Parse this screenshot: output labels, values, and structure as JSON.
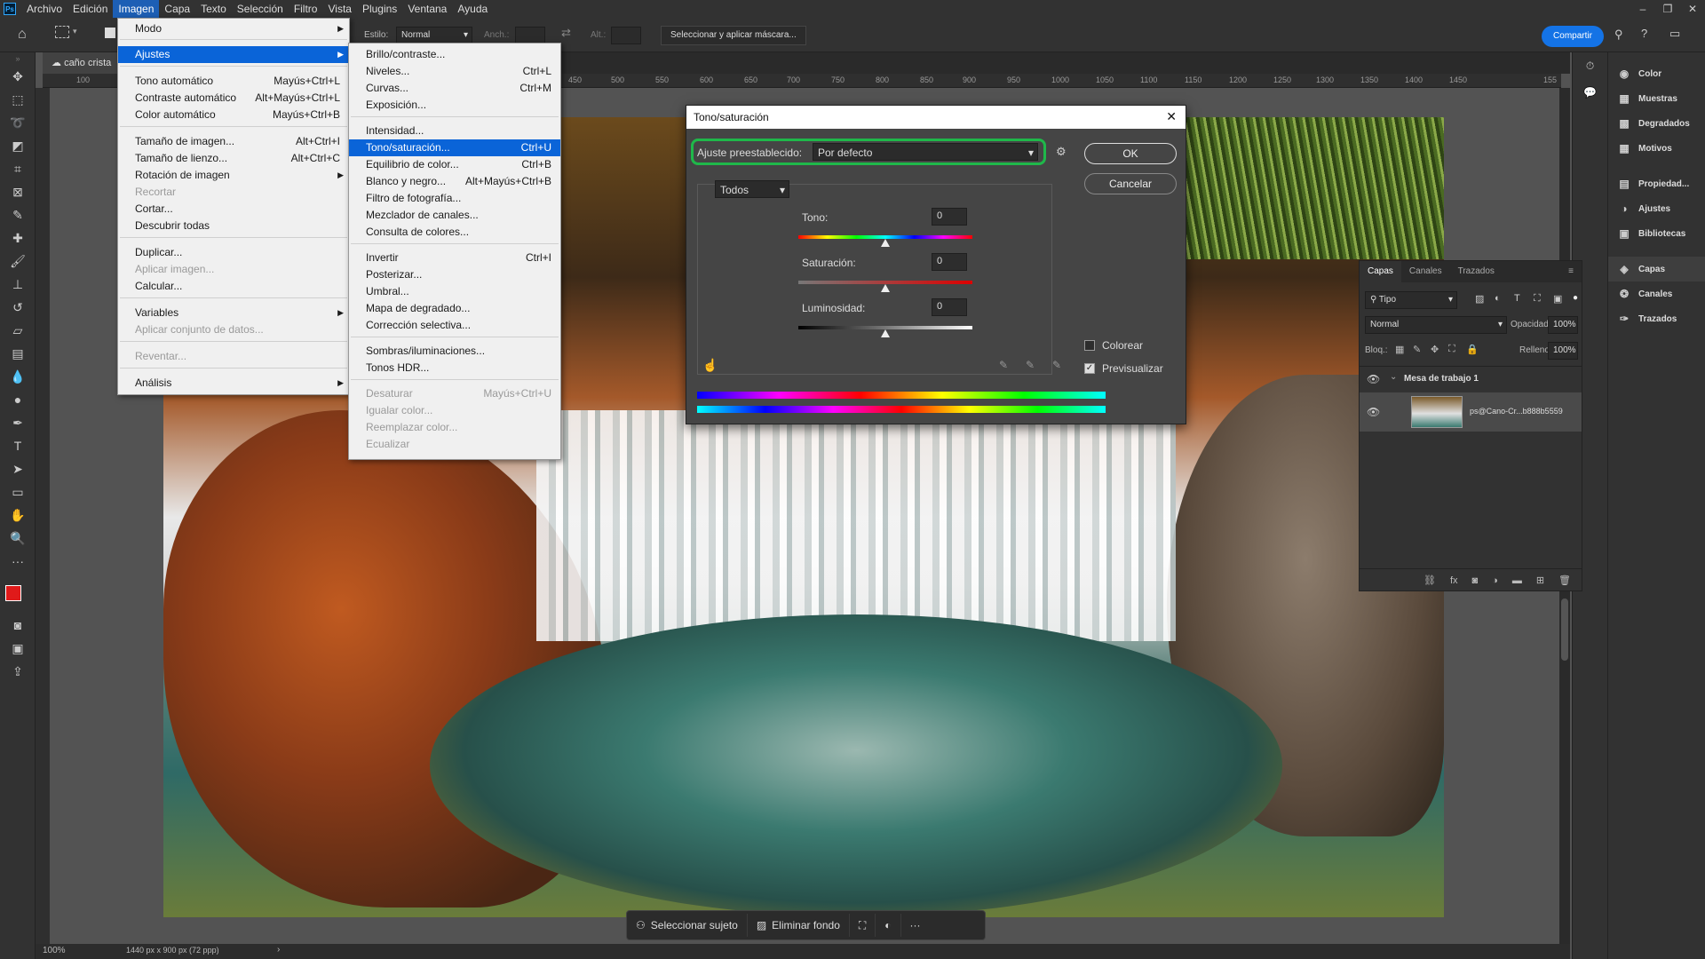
{
  "app": {
    "logo": "Ps"
  },
  "menubar": [
    "Archivo",
    "Edición",
    "Imagen",
    "Capa",
    "Texto",
    "Selección",
    "Filtro",
    "Vista",
    "Plugins",
    "Ventana",
    "Ayuda"
  ],
  "options": {
    "estilo_label": "Estilo:",
    "estilo_value": "Normal",
    "anch_label": "Anch.:",
    "alt_label": "Alt.:",
    "mask_button": "Seleccionar y aplicar máscara...",
    "share_button": "Compartir"
  },
  "doc_tab": {
    "name": "caño crista"
  },
  "ruler_ticks": [
    "100",
    "450",
    "500",
    "550",
    "600",
    "650",
    "700",
    "750",
    "800",
    "850",
    "900",
    "950",
    "1000",
    "1050",
    "1100",
    "1150",
    "1200",
    "1250",
    "1300",
    "1350",
    "1400",
    "1450",
    "155"
  ],
  "image_menu": {
    "items": [
      {
        "label": "Modo",
        "shortcut": "",
        "submenu": true,
        "disabled": false
      },
      {
        "label": "Ajustes",
        "shortcut": "",
        "submenu": true,
        "disabled": false,
        "highlighted": true
      },
      {
        "label": "Tono automático",
        "shortcut": "Mayús+Ctrl+L",
        "disabled": false
      },
      {
        "label": "Contraste automático",
        "shortcut": "Alt+Mayús+Ctrl+L",
        "disabled": false
      },
      {
        "label": "Color automático",
        "shortcut": "Mayús+Ctrl+B",
        "disabled": false
      },
      {
        "label": "Tamaño de imagen...",
        "shortcut": "Alt+Ctrl+I",
        "disabled": false
      },
      {
        "label": "Tamaño de lienzo...",
        "shortcut": "Alt+Ctrl+C",
        "disabled": false
      },
      {
        "label": "Rotación de imagen",
        "shortcut": "",
        "submenu": true,
        "disabled": false
      },
      {
        "label": "Recortar",
        "shortcut": "",
        "disabled": true
      },
      {
        "label": "Cortar...",
        "shortcut": "",
        "disabled": false
      },
      {
        "label": "Descubrir todas",
        "shortcut": "",
        "disabled": false
      },
      {
        "label": "Duplicar...",
        "shortcut": "",
        "disabled": false
      },
      {
        "label": "Aplicar imagen...",
        "shortcut": "",
        "disabled": true
      },
      {
        "label": "Calcular...",
        "shortcut": "",
        "disabled": false
      },
      {
        "label": "Variables",
        "shortcut": "",
        "submenu": true,
        "disabled": false
      },
      {
        "label": "Aplicar conjunto de datos...",
        "shortcut": "",
        "disabled": true
      },
      {
        "label": "Reventar...",
        "shortcut": "",
        "disabled": true
      },
      {
        "label": "Análisis",
        "shortcut": "",
        "submenu": true,
        "disabled": false
      }
    ]
  },
  "adjust_menu": {
    "items": [
      {
        "label": "Brillo/contraste...",
        "shortcut": ""
      },
      {
        "label": "Niveles...",
        "shortcut": "Ctrl+L"
      },
      {
        "label": "Curvas...",
        "shortcut": "Ctrl+M"
      },
      {
        "label": "Exposición...",
        "shortcut": ""
      },
      {
        "label": "Intensidad...",
        "shortcut": ""
      },
      {
        "label": "Tono/saturación...",
        "shortcut": "Ctrl+U",
        "highlighted": true
      },
      {
        "label": "Equilibrio de color...",
        "shortcut": "Ctrl+B"
      },
      {
        "label": "Blanco y negro...",
        "shortcut": "Alt+Mayús+Ctrl+B"
      },
      {
        "label": "Filtro de fotografía...",
        "shortcut": ""
      },
      {
        "label": "Mezclador de canales...",
        "shortcut": ""
      },
      {
        "label": "Consulta de colores...",
        "shortcut": ""
      },
      {
        "label": "Invertir",
        "shortcut": "Ctrl+I"
      },
      {
        "label": "Posterizar...",
        "shortcut": ""
      },
      {
        "label": "Umbral...",
        "shortcut": ""
      },
      {
        "label": "Mapa de degradado...",
        "shortcut": ""
      },
      {
        "label": "Corrección selectiva...",
        "shortcut": ""
      },
      {
        "label": "Sombras/iluminaciones...",
        "shortcut": ""
      },
      {
        "label": "Tonos HDR...",
        "shortcut": ""
      },
      {
        "label": "Desaturar",
        "shortcut": "Mayús+Ctrl+U",
        "disabled": true
      },
      {
        "label": "Igualar color...",
        "shortcut": "",
        "disabled": true
      },
      {
        "label": "Reemplazar color...",
        "shortcut": "",
        "disabled": true
      },
      {
        "label": "Ecualizar",
        "shortcut": "",
        "disabled": true
      }
    ]
  },
  "dialog": {
    "title": "Tono/saturación",
    "preset_label": "Ajuste preestablecido:",
    "preset_value": "Por defecto",
    "channel": "Todos",
    "tono_label": "Tono:",
    "tono_value": "0",
    "sat_label": "Saturación:",
    "sat_value": "0",
    "lum_label": "Luminosidad:",
    "lum_value": "0",
    "ok": "OK",
    "cancel": "Cancelar",
    "colorear": "Colorear",
    "colorear_checked": false,
    "preview": "Previsualizar",
    "preview_checked": true,
    "preset_highlight_color": "#1fb84a"
  },
  "dock_right": [
    {
      "label": "Color",
      "icon": "color-icon"
    },
    {
      "label": "Muestras",
      "icon": "swatches-icon"
    },
    {
      "label": "Degradados",
      "icon": "gradients-icon"
    },
    {
      "label": "Motivos",
      "icon": "patterns-icon"
    },
    {
      "label": "Propiedad...",
      "icon": "properties-icon"
    },
    {
      "label": "Ajustes",
      "icon": "adjustments-icon"
    },
    {
      "label": "Bibliotecas",
      "icon": "libraries-icon"
    },
    {
      "label": "Capas",
      "icon": "layers-icon",
      "selected": true
    },
    {
      "label": "Canales",
      "icon": "channels-icon"
    },
    {
      "label": "Trazados",
      "icon": "paths-icon"
    }
  ],
  "layers_panel": {
    "tabs": [
      "Capas",
      "Canales",
      "Trazados"
    ],
    "filter": "Tipo",
    "blend": "Normal",
    "opacity_label": "Opacidad:",
    "opacity": "100%",
    "lock_label": "Bloq.:",
    "fill_label": "Relleno:",
    "fill": "100%",
    "group": "Mesa de trabajo 1",
    "layer": "ps@Cano-Cr...b888b5559"
  },
  "context_bar": {
    "select_subject": "Seleccionar sujeto",
    "remove_bg": "Eliminar fondo"
  },
  "status": {
    "zoom": "100%",
    "info": "1440 px x 900 px (72 ppp)"
  }
}
